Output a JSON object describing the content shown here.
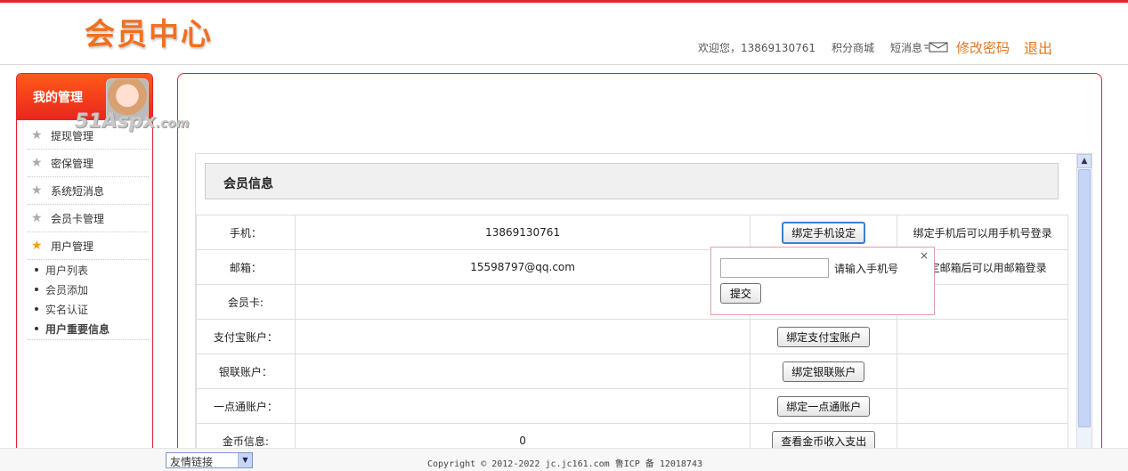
{
  "header": {
    "logo": "会员中心",
    "welcome": "欢迎您，13869130761",
    "points_mall": "积分商城",
    "messages": "短消息",
    "change_password": "修改密码",
    "logout": "退出"
  },
  "sidebar": {
    "title": "我的管理",
    "watermark": "51Aspx",
    "watermark_suffix": ".com",
    "items": [
      {
        "label": "提现管理",
        "icon": "star-icon"
      },
      {
        "label": "密保管理",
        "icon": "star-icon"
      },
      {
        "label": "系统短消息",
        "icon": "star-icon"
      },
      {
        "label": "会员卡管理",
        "icon": "star-icon"
      },
      {
        "label": "用户管理",
        "icon": "star-icon-active"
      }
    ],
    "subitems": [
      {
        "label": "用户列表"
      },
      {
        "label": "会员添加"
      },
      {
        "label": "实名认证"
      },
      {
        "label": "用户重要信息"
      }
    ]
  },
  "main": {
    "section_title": "会员信息",
    "rows": [
      {
        "label": "手机：",
        "value": "13869130761",
        "button": "绑定手机设定",
        "note": "绑定手机后可以用手机号登录"
      },
      {
        "label": "邮箱：",
        "value": "15598797@qq.com",
        "button": "",
        "note": "绑定邮箱后可以用邮箱登录"
      },
      {
        "label": "会员卡:",
        "value": "",
        "button": "",
        "note": ""
      },
      {
        "label": "支付宝账户：",
        "value": "",
        "button": "绑定支付宝账户",
        "note": ""
      },
      {
        "label": "银联账户：",
        "value": "",
        "button": "绑定银联账户",
        "note": ""
      },
      {
        "label": "一点通账户：",
        "value": "",
        "button": "绑定一点通账户",
        "note": ""
      },
      {
        "label": "金币信息:",
        "value": "0",
        "button": "查看金币收入支出",
        "note": ""
      }
    ]
  },
  "popup": {
    "close": "×",
    "input_value": "",
    "hint": "请输入手机号",
    "submit": "提交"
  },
  "footer": {
    "links_select": "友情链接",
    "copyright": "Copyright © 2012-2022 jc.jc161.com 鲁ICP 备 12018743"
  }
}
